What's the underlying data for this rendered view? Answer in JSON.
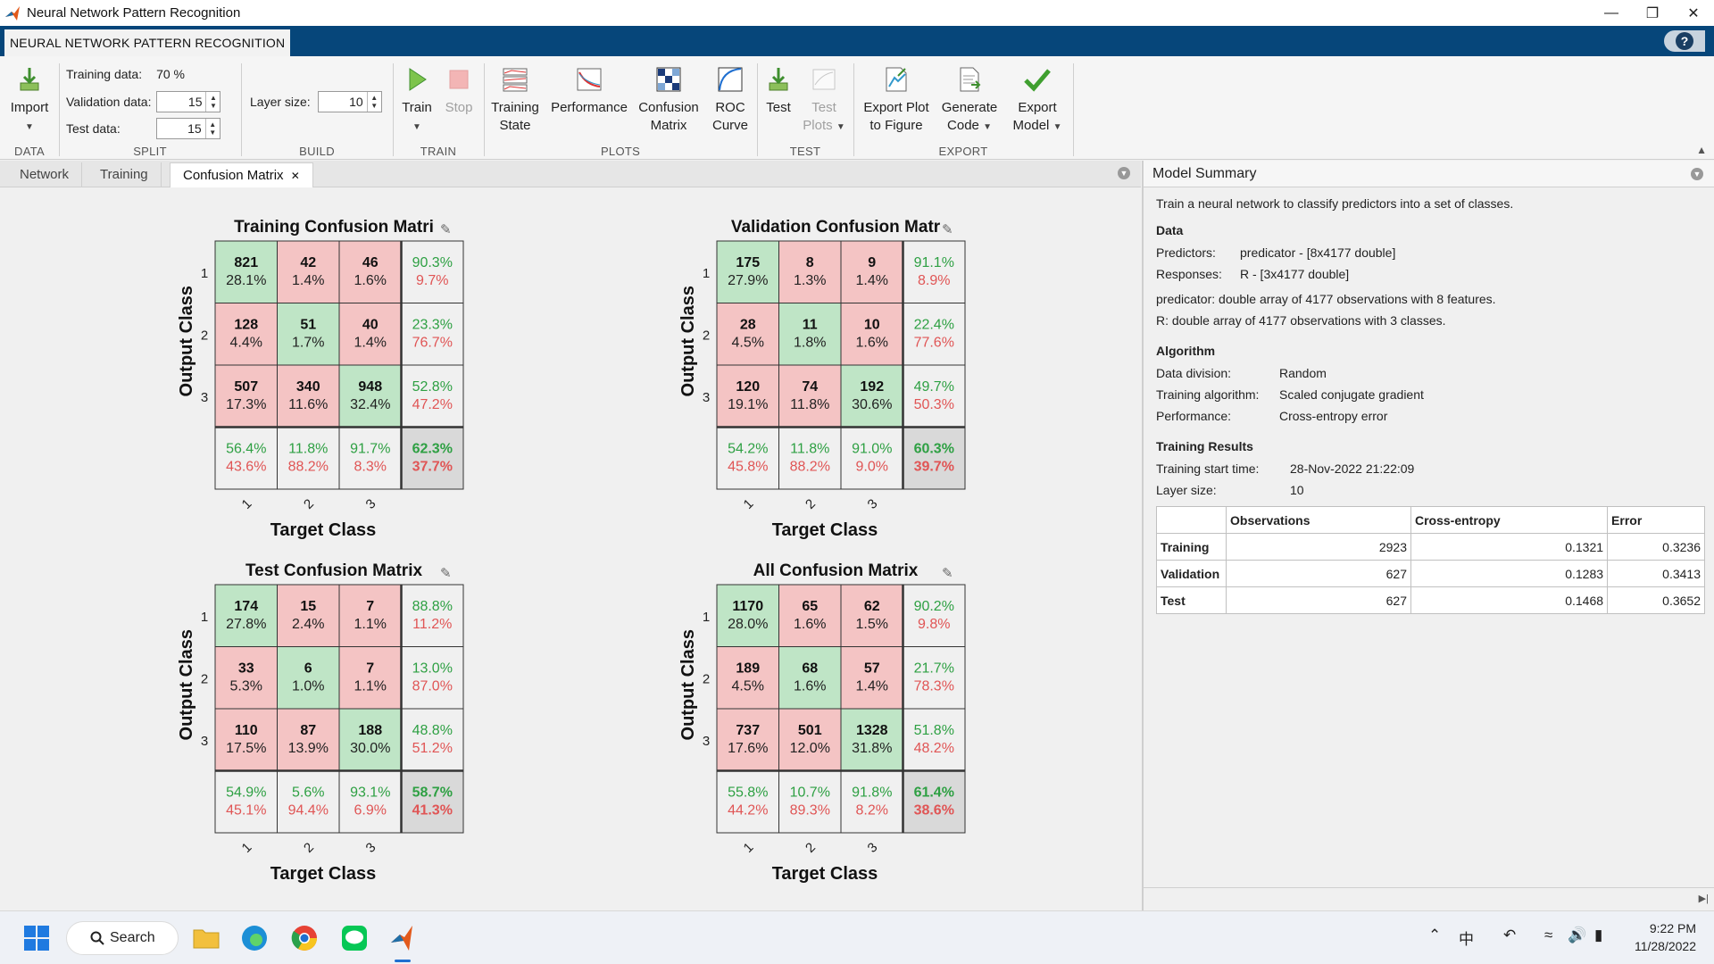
{
  "window": {
    "title": "Neural Network Pattern Recognition"
  },
  "app_tab": "NEURAL NETWORK PATTERN RECOGNITION",
  "toolstrip": {
    "data": {
      "import_label": "Import",
      "group": "DATA"
    },
    "split": {
      "training_label": "Training data:",
      "training_value": "70 %",
      "validation_label": "Validation data:",
      "validation_value": "15",
      "test_label": "Test data:",
      "test_value": "15",
      "group": "SPLIT"
    },
    "build": {
      "layer_label": "Layer size:",
      "layer_value": "10",
      "group": "BUILD"
    },
    "train": {
      "train_label": "Train",
      "stop_label": "Stop",
      "group": "TRAIN"
    },
    "plots": {
      "training_state_1": "Training",
      "training_state_2": "State",
      "performance": "Performance",
      "confusion_1": "Confusion",
      "confusion_2": "Matrix",
      "roc_1": "ROC",
      "roc_2": "Curve",
      "group": "PLOTS"
    },
    "test": {
      "test_label": "Test",
      "test_plots_1": "Test",
      "test_plots_2": "Plots",
      "group": "TEST"
    },
    "export": {
      "plot_1": "Export Plot",
      "plot_2": "to Figure",
      "code_1": "Generate",
      "code_2": "Code",
      "model_1": "Export",
      "model_2": "Model",
      "group": "EXPORT"
    }
  },
  "doc_tabs": [
    "Network",
    "Training",
    "Confusion Matrix"
  ],
  "chart_data": [
    {
      "type": "heatmap",
      "title": "Training Confusion Matri",
      "xlabel": "Target Class",
      "ylabel": "Output Class",
      "class_labels": [
        "1",
        "2",
        "3"
      ],
      "counts": [
        [
          821,
          42,
          46
        ],
        [
          128,
          51,
          40
        ],
        [
          507,
          340,
          948
        ]
      ],
      "percents": [
        [
          "28.1%",
          "1.4%",
          "1.6%"
        ],
        [
          "4.4%",
          "1.7%",
          "1.4%"
        ],
        [
          "17.3%",
          "11.6%",
          "32.4%"
        ]
      ],
      "row_summary": [
        [
          "90.3%",
          "9.7%"
        ],
        [
          "23.3%",
          "76.7%"
        ],
        [
          "52.8%",
          "47.2%"
        ]
      ],
      "col_summary": [
        [
          "56.4%",
          "43.6%"
        ],
        [
          "11.8%",
          "88.2%"
        ],
        [
          "91.7%",
          "8.3%"
        ]
      ],
      "overall": [
        "62.3%",
        "37.7%"
      ]
    },
    {
      "type": "heatmap",
      "title": "Validation Confusion Matr",
      "xlabel": "Target Class",
      "ylabel": "Output Class",
      "class_labels": [
        "1",
        "2",
        "3"
      ],
      "counts": [
        [
          175,
          8,
          9
        ],
        [
          28,
          11,
          10
        ],
        [
          120,
          74,
          192
        ]
      ],
      "percents": [
        [
          "27.9%",
          "1.3%",
          "1.4%"
        ],
        [
          "4.5%",
          "1.8%",
          "1.6%"
        ],
        [
          "19.1%",
          "11.8%",
          "30.6%"
        ]
      ],
      "row_summary": [
        [
          "91.1%",
          "8.9%"
        ],
        [
          "22.4%",
          "77.6%"
        ],
        [
          "49.7%",
          "50.3%"
        ]
      ],
      "col_summary": [
        [
          "54.2%",
          "45.8%"
        ],
        [
          "11.8%",
          "88.2%"
        ],
        [
          "91.0%",
          "9.0%"
        ]
      ],
      "overall": [
        "60.3%",
        "39.7%"
      ]
    },
    {
      "type": "heatmap",
      "title": "Test Confusion Matrix",
      "xlabel": "Target Class",
      "ylabel": "Output Class",
      "class_labels": [
        "1",
        "2",
        "3"
      ],
      "counts": [
        [
          174,
          15,
          7
        ],
        [
          33,
          6,
          7
        ],
        [
          110,
          87,
          188
        ]
      ],
      "percents": [
        [
          "27.8%",
          "2.4%",
          "1.1%"
        ],
        [
          "5.3%",
          "1.0%",
          "1.1%"
        ],
        [
          "17.5%",
          "13.9%",
          "30.0%"
        ]
      ],
      "row_summary": [
        [
          "88.8%",
          "11.2%"
        ],
        [
          "13.0%",
          "87.0%"
        ],
        [
          "48.8%",
          "51.2%"
        ]
      ],
      "col_summary": [
        [
          "54.9%",
          "45.1%"
        ],
        [
          "5.6%",
          "94.4%"
        ],
        [
          "93.1%",
          "6.9%"
        ]
      ],
      "overall": [
        "58.7%",
        "41.3%"
      ]
    },
    {
      "type": "heatmap",
      "title": "All Confusion Matrix",
      "xlabel": "Target Class",
      "ylabel": "Output Class",
      "class_labels": [
        "1",
        "2",
        "3"
      ],
      "counts": [
        [
          1170,
          65,
          62
        ],
        [
          189,
          68,
          57
        ],
        [
          737,
          501,
          1328
        ]
      ],
      "percents": [
        [
          "28.0%",
          "1.6%",
          "1.5%"
        ],
        [
          "4.5%",
          "1.6%",
          "1.4%"
        ],
        [
          "17.6%",
          "12.0%",
          "31.8%"
        ]
      ],
      "row_summary": [
        [
          "90.2%",
          "9.8%"
        ],
        [
          "21.7%",
          "78.3%"
        ],
        [
          "51.8%",
          "48.2%"
        ]
      ],
      "col_summary": [
        [
          "55.8%",
          "44.2%"
        ],
        [
          "10.7%",
          "89.3%"
        ],
        [
          "91.8%",
          "8.2%"
        ]
      ],
      "overall": [
        "61.4%",
        "38.6%"
      ]
    }
  ],
  "colors": {
    "correct": "#bfe5c6",
    "incorrect": "#f4c4c4",
    "summary": "#f0f0f0",
    "overall": "#d9d9d9",
    "green_text": "#2ea043",
    "red_text": "#e05555",
    "title_blue": "#06467a"
  },
  "summary": {
    "header": "Model Summary",
    "intro": "Train a neural network to classify predictors into a set of classes.",
    "data_title": "Data",
    "predictors_k": "Predictors:",
    "predictors_v": "predicator - [8x4177 double]",
    "responses_k": "Responses:",
    "responses_v": "R - [3x4177 double]",
    "desc1": "predicator: double array of 4177 observations with 8 features.",
    "desc2": "R: double array of 4177 observations with 3 classes.",
    "alg_title": "Algorithm",
    "division_k": "Data division:",
    "division_v": "Random",
    "alg_k": "Training algorithm:",
    "alg_v": "Scaled conjugate gradient",
    "perf_k": "Performance:",
    "perf_v": "Cross-entropy error",
    "res_title": "Training Results",
    "start_k": "Training start time:",
    "start_v": "28-Nov-2022 21:22:09",
    "layer_k": "Layer size:",
    "layer_v": "10",
    "table_headers": [
      "Observations",
      "Cross-entropy",
      "Error"
    ],
    "table_rows": [
      {
        "name": "Training",
        "obs": "2923",
        "ce": "0.1321",
        "err": "0.3236"
      },
      {
        "name": "Validation",
        "obs": "627",
        "ce": "0.1283",
        "err": "0.3413"
      },
      {
        "name": "Test",
        "obs": "627",
        "ce": "0.1468",
        "err": "0.3652"
      }
    ]
  },
  "taskbar": {
    "search": "Search",
    "time": "9:22 PM",
    "date": "11/28/2022",
    "ime": "中"
  }
}
